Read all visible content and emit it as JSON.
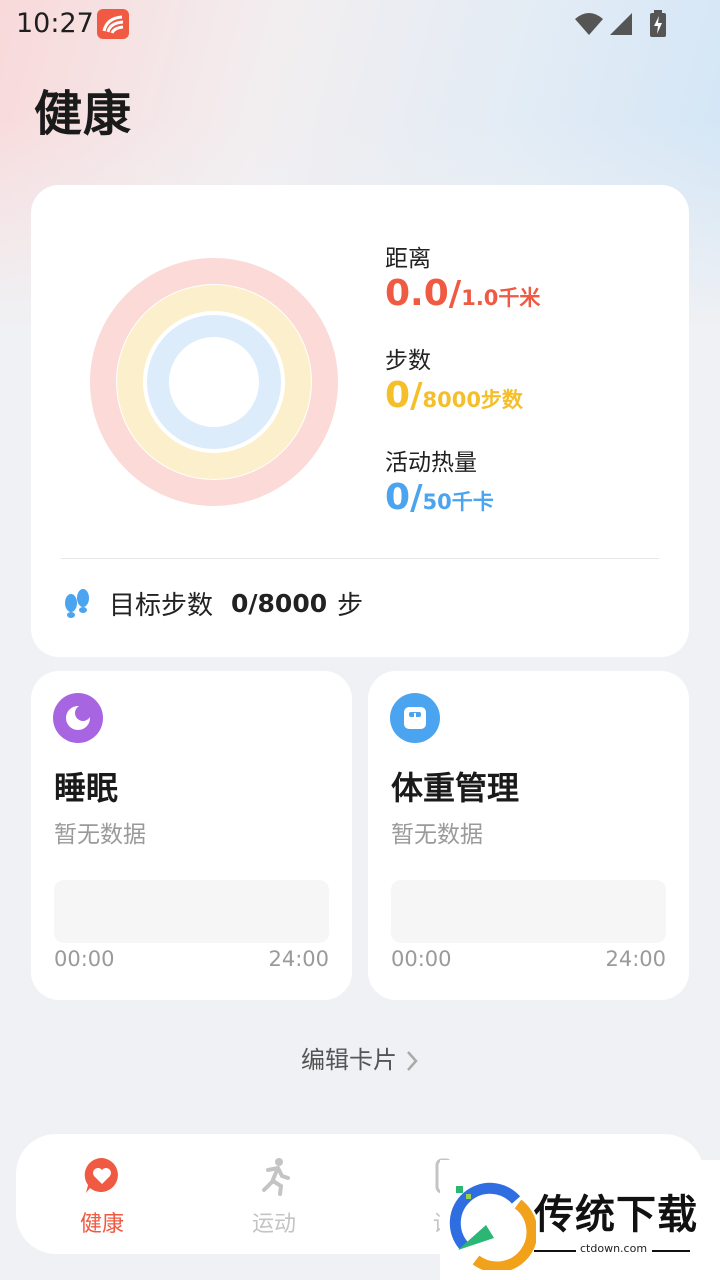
{
  "status_bar": {
    "time": "10:27"
  },
  "page": {
    "title": "健康"
  },
  "activity": {
    "distance": {
      "label": "距离",
      "value": "0.0",
      "goal": "1.0千米",
      "color": "#f05a43"
    },
    "steps": {
      "label": "步数",
      "value": "0",
      "goal": "8000步数",
      "color": "#f5bf2a"
    },
    "calories": {
      "label": "活动热量",
      "value": "0",
      "goal": "50千卡",
      "color": "#4ba4ef"
    },
    "slash": "/"
  },
  "goal_row": {
    "label": "目标步数",
    "value": "0/8000",
    "unit": "步"
  },
  "sleep": {
    "title": "睡眠",
    "subtitle": "暂无数据",
    "axis_start": "00:00",
    "axis_end": "24:00",
    "icon": "moon-icon"
  },
  "weight": {
    "title": "体重管理",
    "subtitle": "暂无数据",
    "axis_start": "00:00",
    "axis_end": "24:00",
    "icon": "scale-icon"
  },
  "edit_cards": {
    "label": "编辑卡片"
  },
  "nav": {
    "items": [
      {
        "label": "健康",
        "icon": "heart-icon",
        "active": true
      },
      {
        "label": "运动",
        "icon": "runner-icon",
        "active": false
      },
      {
        "label": "设",
        "icon": "device-icon",
        "active": false
      }
    ]
  },
  "watermark": {
    "text": "传统下载",
    "url": "ctdown.com"
  },
  "colors": {
    "accent": "#f05a43",
    "inactive": "#c4c4c4"
  }
}
